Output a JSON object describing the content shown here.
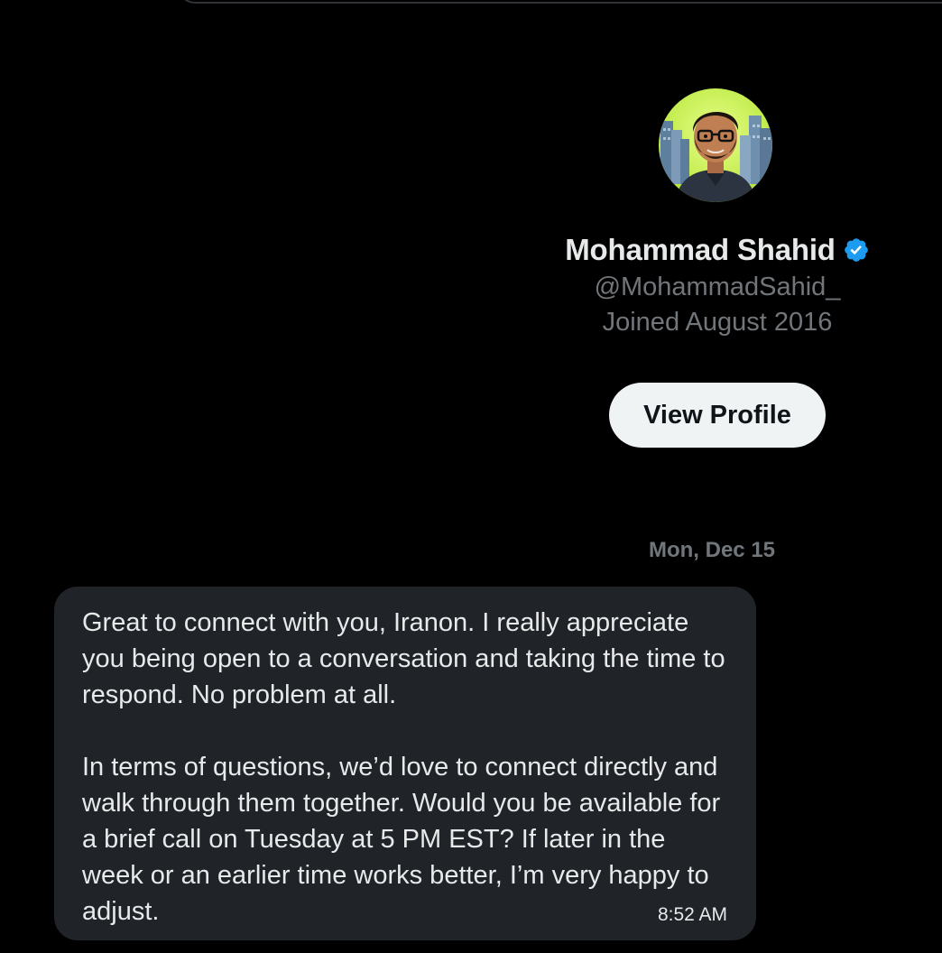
{
  "profile": {
    "name": "Mohammad Shahid",
    "handle": "@MohammadSahid_",
    "joined": "Joined August 2016",
    "view_profile_label": "View Profile",
    "avatar_icon": "avatar-illustration",
    "verified_icon": "verified-badge-icon",
    "verified_color": "#1d9bf0"
  },
  "conversation": {
    "date_separator": "Mon, Dec 15",
    "messages": [
      {
        "paragraphs": [
          "Great to connect with you, Iranon. I really appreciate you being open to a conversation and taking the time to respond. No problem at all.",
          "In terms of questions, we’d love to connect directly and walk through them together. Would you be available for a brief call on Tuesday at 5 PM EST? If later in the week or an earlier time works better, I’m very happy to adjust."
        ],
        "time": "8:52 AM"
      }
    ]
  },
  "colors": {
    "background": "#000000",
    "bubble": "#202327",
    "secondary_text": "#71767b",
    "button_bg": "#eff3f4"
  }
}
